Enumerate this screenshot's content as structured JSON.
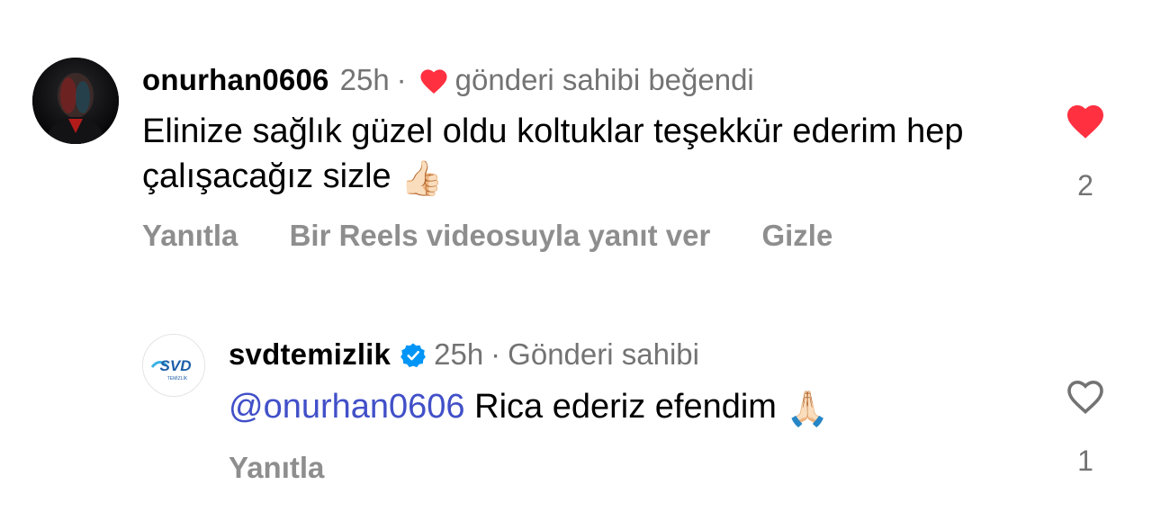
{
  "comments": [
    {
      "username": "onurhan0606",
      "time": "25h",
      "separator": "·",
      "liked_by_author_text": "gönderi sahibi beğendi",
      "text": "Elinize sağlık güzel oldu koltuklar teşekkür ederim hep çalışacağız sizle",
      "emoji": "👍🏻",
      "actions": {
        "reply": "Yanıtla",
        "reels_reply": "Bir Reels videosuyla yanıt ver",
        "hide": "Gizle"
      },
      "like_count": "2",
      "liked": true,
      "avatar_icon": "user-avatar-photo"
    },
    {
      "username": "svdtemizlik",
      "verified": true,
      "time": "25h",
      "separator": "·",
      "author_label": "Gönderi sahibi",
      "mention": "@onurhan0606",
      "text": "Rica ederiz efendim",
      "emoji": "🙏🏻",
      "actions": {
        "reply": "Yanıtla"
      },
      "like_count": "1",
      "liked": false,
      "avatar_logo_text": "SVD",
      "avatar_logo_subtext": "TEMİZLİK"
    }
  ],
  "colors": {
    "heart_red": "#ff3040",
    "mention_blue": "#4150c8",
    "verified_blue": "#0095f6",
    "muted_gray": "#737373"
  }
}
